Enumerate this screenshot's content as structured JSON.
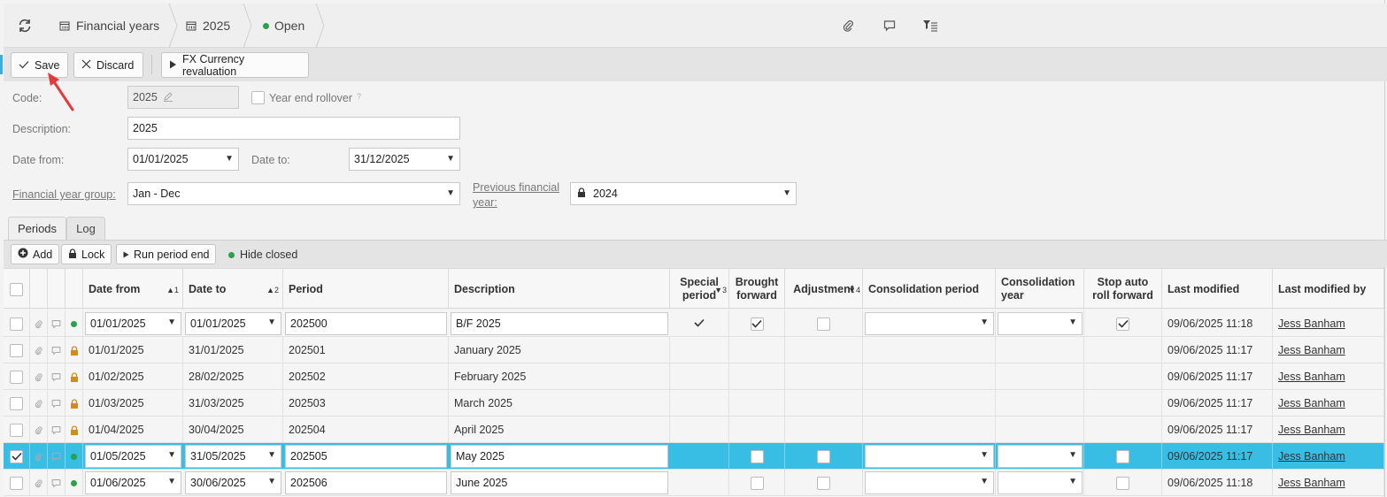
{
  "breadcrumb": {
    "items": [
      {
        "label": "Financial years"
      },
      {
        "label": "2025"
      },
      {
        "label": "Open"
      }
    ]
  },
  "toolbar": {
    "save_label": "Save",
    "discard_label": "Discard",
    "fx_label": "FX Currency revaluation"
  },
  "form": {
    "code_label": "Code:",
    "code_value": "2025",
    "year_end_label": "Year end rollover",
    "help_mark": "?",
    "description_label": "Description:",
    "description_value": "2025",
    "date_from_label": "Date from:",
    "date_from_value": "01/01/2025",
    "date_to_label": "Date to:",
    "date_to_value": "31/12/2025",
    "fy_group_label": "Financial year group:",
    "fy_group_value": "Jan - Dec",
    "prev_fy_label_line1": "Previous financial",
    "prev_fy_label_line2": "year:",
    "prev_fy_value": "2024"
  },
  "tabs": [
    {
      "label": "Periods"
    },
    {
      "label": "Log"
    }
  ],
  "subtoolbar": {
    "add_label": "Add",
    "lock_label": "Lock",
    "run_label": "Run period end",
    "hide_closed_label": "Hide closed"
  },
  "grid": {
    "headers": {
      "date_from": "Date from",
      "date_to": "Date to",
      "period": "Period",
      "description": "Description",
      "special_l1": "Special",
      "special_l2": "period",
      "brought_l1": "Brought",
      "brought_l2": "forward",
      "adjustment": "Adjustment",
      "consol_period": "Consolidation period",
      "consol_year_l1": "Consolidation",
      "consol_year_l2": "year",
      "stop_l1": "Stop auto",
      "stop_l2": "roll forward",
      "last_modified": "Last modified",
      "last_modified_by": "Last modified by"
    },
    "sort_marks": {
      "date_from": "▲1",
      "date_to": "▲2",
      "special": "▼3",
      "adjustment": "▼4"
    },
    "rows": [
      {
        "date_from": "01/01/2025",
        "date_to": "01/01/2025",
        "period": "202500",
        "description": "B/F 2025",
        "last_modified": "09/06/2025 11:18",
        "last_modified_by": "Jess Banham"
      },
      {
        "date_from": "01/01/2025",
        "date_to": "31/01/2025",
        "period": "202501",
        "description": "January 2025",
        "last_modified": "09/06/2025 11:17",
        "last_modified_by": "Jess Banham"
      },
      {
        "date_from": "01/02/2025",
        "date_to": "28/02/2025",
        "period": "202502",
        "description": "February 2025",
        "last_modified": "09/06/2025 11:17",
        "last_modified_by": "Jess Banham"
      },
      {
        "date_from": "01/03/2025",
        "date_to": "31/03/2025",
        "period": "202503",
        "description": "March 2025",
        "last_modified": "09/06/2025 11:17",
        "last_modified_by": "Jess Banham"
      },
      {
        "date_from": "01/04/2025",
        "date_to": "30/04/2025",
        "period": "202504",
        "description": "April 2025",
        "last_modified": "09/06/2025 11:17",
        "last_modified_by": "Jess Banham"
      },
      {
        "date_from": "01/05/2025",
        "date_to": "31/05/2025",
        "period": "202505",
        "description": "May 2025",
        "last_modified": "09/06/2025 11:17",
        "last_modified_by": "Jess Banham"
      },
      {
        "date_from": "01/06/2025",
        "date_to": "30/06/2025",
        "period": "202506",
        "description": "June 2025",
        "last_modified": "09/06/2025 11:18",
        "last_modified_by": "Jess Banham"
      }
    ]
  },
  "colors": {
    "selected_row": "#38bde4",
    "status_green": "#2aa14a",
    "lock_orange": "#d28c1e",
    "annotation_red": "#e23b3b"
  }
}
